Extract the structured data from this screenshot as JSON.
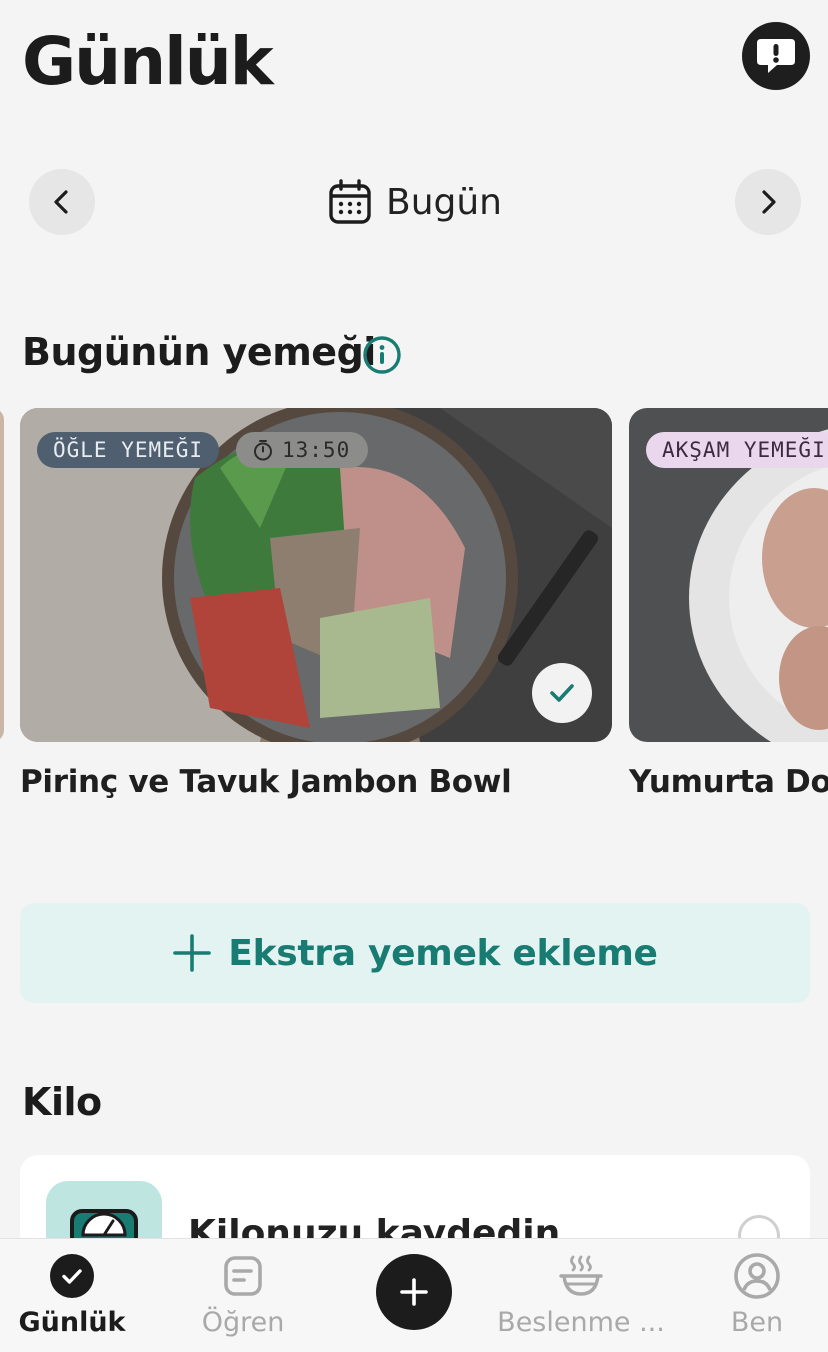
{
  "header": {
    "title": "Günlük",
    "alert_icon": "feedback-alert-icon"
  },
  "date_nav": {
    "label": "Bugün",
    "prev_icon": "chevron-left-icon",
    "next_icon": "chevron-right-icon",
    "calendar_icon": "calendar-icon"
  },
  "meals_section": {
    "title": "Bugünün yemeği",
    "cards": [
      {
        "meal_type": "ÖĞLE YEMEĞI",
        "time": "13:50",
        "name": "Pirinç ve Tavuk Jambon Bowl",
        "completed": true
      },
      {
        "meal_type": "AKŞAM YEMEĞI",
        "name": "Yumurta Dolı"
      }
    ]
  },
  "add_meal": {
    "label": "Ekstra yemek ekleme"
  },
  "weight_section": {
    "title": "Kilo",
    "prompt": "Kilonuzu kaydedin"
  },
  "tabbar": {
    "tabs": [
      {
        "label": "Günlük",
        "icon": "check-circle-icon",
        "active": true
      },
      {
        "label": "Öğren",
        "icon": "article-icon"
      },
      {
        "label": "Beslenme ...",
        "icon": "bowl-icon"
      },
      {
        "label": "Ben",
        "icon": "profile-icon"
      }
    ],
    "fab_icon": "plus-icon"
  },
  "colors": {
    "accent": "#187c72",
    "background": "#f4f4f4",
    "add_meal_bg": "#e3f3f1",
    "dark": "#1c1c1c"
  }
}
